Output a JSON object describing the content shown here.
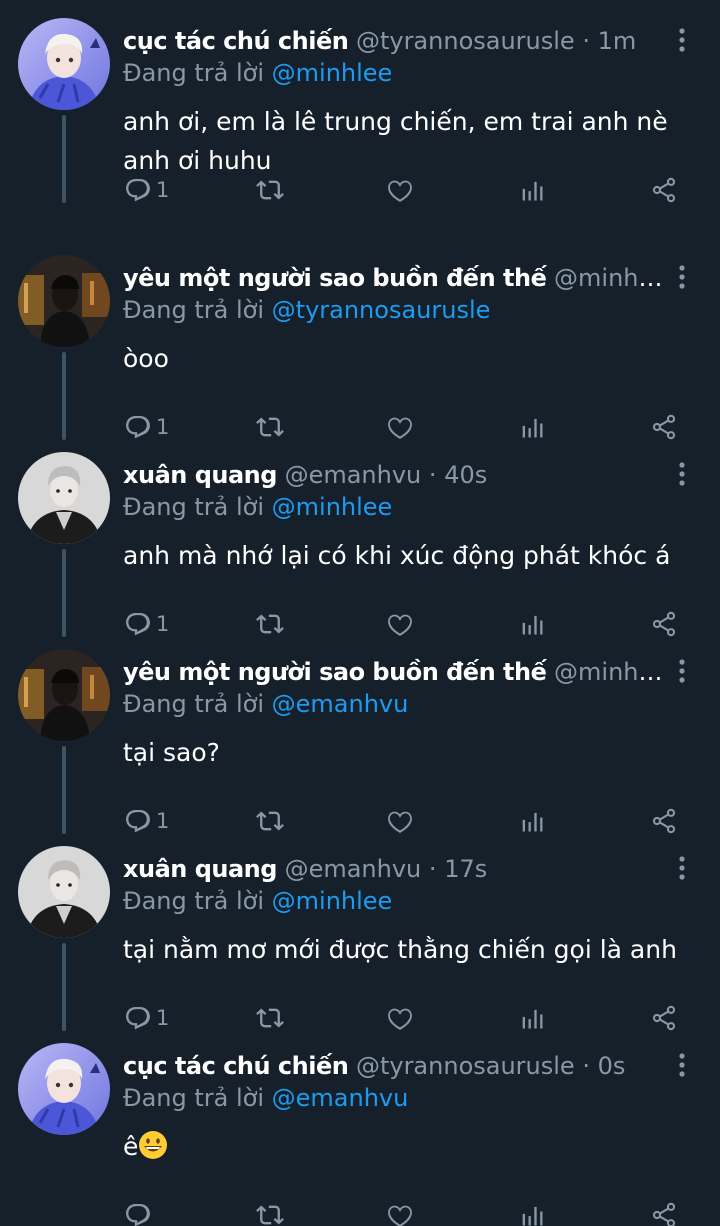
{
  "tweets": [
    {
      "name": "cục tác chú chiến",
      "handle": "@tyrannosaurusle",
      "dot": "·",
      "time": "1m",
      "reply_prefix": "Đang trả lời",
      "reply_to": "@minhlee",
      "text": "anh ơi, em là lê trung chiến, em trai anh nè anh ơi huhu",
      "reply_count": "1",
      "avatar": "avatar-blue-illustration"
    },
    {
      "name": "yêu một người sao buồn đến thế",
      "handle": "@minhlee",
      "dot": "·...",
      "time": "",
      "reply_prefix": "Đang trả lời",
      "reply_to": "@tyrannosaurusle",
      "text": "òoo",
      "reply_count": "1",
      "avatar": "avatar-dark-city"
    },
    {
      "name": "xuân quang",
      "handle": "@emanhvu",
      "dot": "·",
      "time": "40s",
      "reply_prefix": "Đang trả lời",
      "reply_to": "@minhlee",
      "text": "anh mà nhớ lại có khi xúc động phát khóc á",
      "reply_count": "1",
      "avatar": "avatar-grayscale-portrait"
    },
    {
      "name": "yêu một người sao buồn đến thế",
      "handle": "@minhlee",
      "dot": "·...",
      "time": "",
      "reply_prefix": "Đang trả lời",
      "reply_to": "@emanhvu",
      "text": "tại sao?",
      "reply_count": "1",
      "avatar": "avatar-dark-city"
    },
    {
      "name": "xuân quang",
      "handle": "@emanhvu",
      "dot": "·",
      "time": "17s",
      "reply_prefix": "Đang trả lời",
      "reply_to": "@minhlee",
      "text": "tại nằm mơ mới được thằng chiến gọi là anh",
      "reply_count": "1",
      "avatar": "avatar-grayscale-portrait"
    },
    {
      "name": "cục tác chú chiến",
      "handle": "@tyrannosaurusle",
      "dot": "·",
      "time": "0s",
      "reply_prefix": "Đang trả lời",
      "reply_to": "@emanhvu",
      "text": "ê",
      "emoji": "grinning-face-emoji",
      "reply_count": "",
      "avatar": "avatar-blue-illustration"
    }
  ],
  "icons": {
    "reply": "reply-icon",
    "retweet": "retweet-icon",
    "like": "like-icon",
    "analytics": "analytics-icon",
    "share": "share-icon",
    "more": "more-icon"
  },
  "colors": {
    "background": "#15202b",
    "accent": "#1d9bf0",
    "secondary_text": "#8899a6",
    "thread_line": "#3d5466"
  }
}
